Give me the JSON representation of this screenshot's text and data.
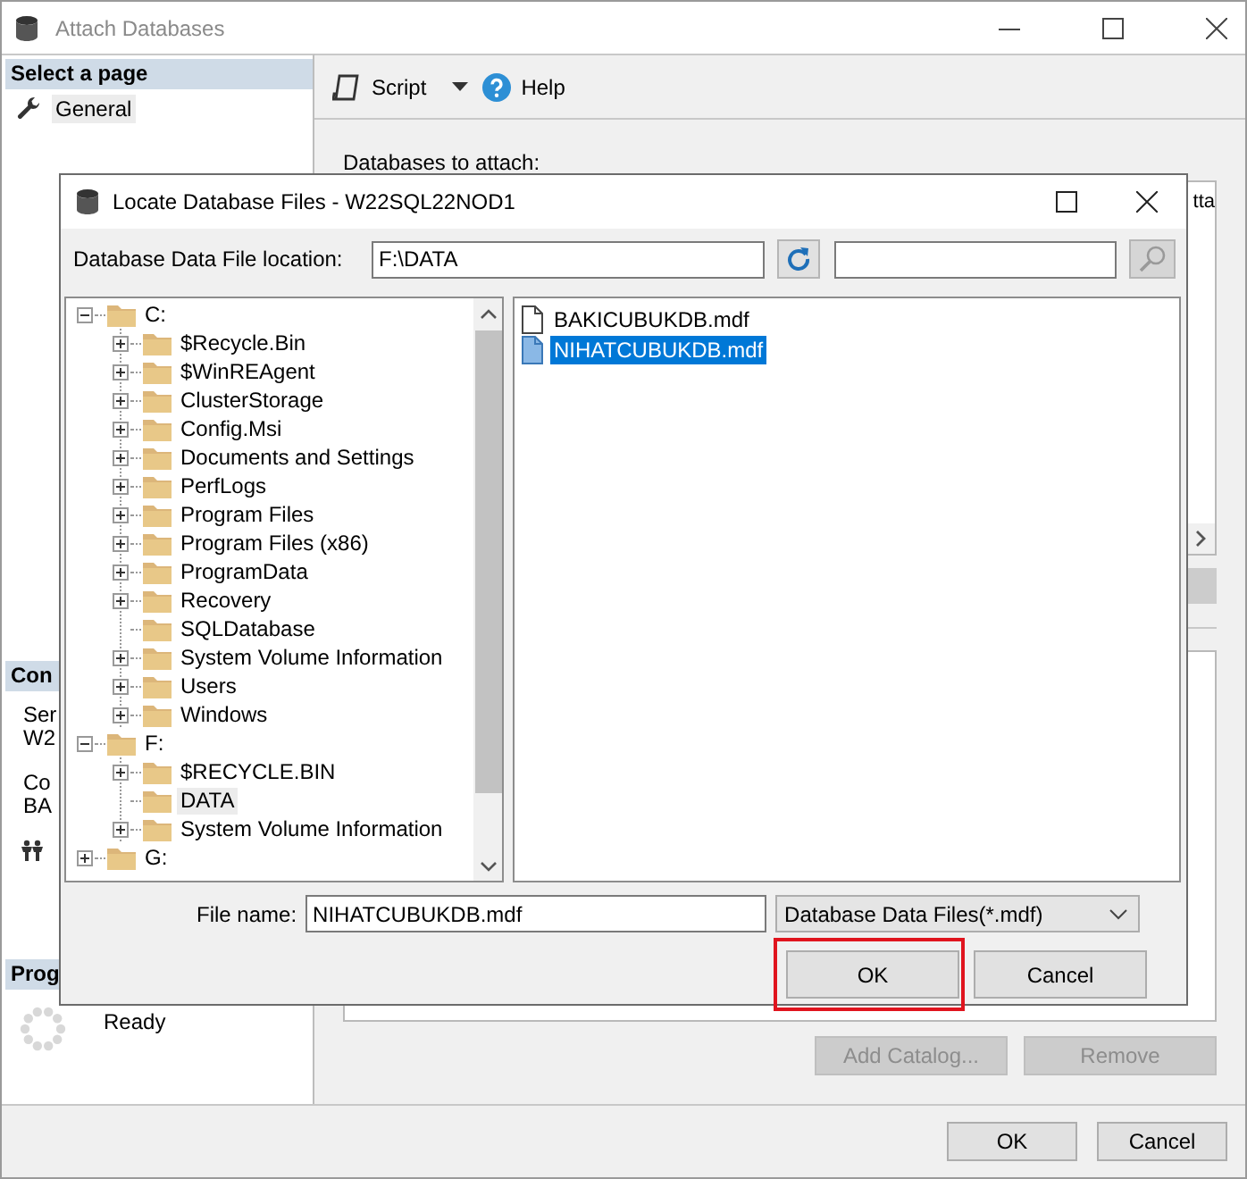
{
  "window": {
    "title": "Attach Databases"
  },
  "sidebar": {
    "sections": [
      {
        "kind": "pages",
        "header": "Select a page",
        "items": [
          {
            "label": "General",
            "selected": true
          }
        ]
      },
      {
        "kind": "connection",
        "header": "Con",
        "lines": [
          "Ser",
          "W2",
          "Co",
          "BA"
        ]
      },
      {
        "kind": "progress",
        "header": "Prog",
        "status": "Ready"
      }
    ]
  },
  "toolbar": {
    "items": [
      {
        "kind": "dropdown",
        "label": "Script"
      },
      {
        "kind": "help",
        "label": "Help"
      }
    ]
  },
  "attach": {
    "label": "Databases to attach:",
    "grid_header": "tta",
    "buttons": [
      {
        "label": "Add Catalog...",
        "disabled": true
      },
      {
        "label": "Remove",
        "disabled": true
      }
    ]
  },
  "footer": {
    "buttons": [
      "OK",
      "Cancel"
    ]
  },
  "dialog": {
    "title": "Locate Database Files - W22SQL22NOD1",
    "location_label": "Database Data File location:",
    "location": "F:\\DATA",
    "tree": [
      {
        "label": "C:",
        "kind": "node",
        "expanded": true,
        "selected": false,
        "children": [
          {
            "label": "$Recycle.Bin",
            "kind": "node",
            "expanded": false,
            "selected": false
          },
          {
            "label": "$WinREAgent",
            "kind": "node",
            "expanded": false,
            "selected": false
          },
          {
            "label": "ClusterStorage",
            "kind": "node",
            "expanded": false,
            "selected": false
          },
          {
            "label": "Config.Msi",
            "kind": "node",
            "expanded": false,
            "selected": false
          },
          {
            "label": "Documents and Settings",
            "kind": "node",
            "expanded": false,
            "selected": false
          },
          {
            "label": "PerfLogs",
            "kind": "node",
            "expanded": false,
            "selected": false
          },
          {
            "label": "Program Files",
            "kind": "node",
            "expanded": false,
            "selected": false
          },
          {
            "label": "Program Files (x86)",
            "kind": "node",
            "expanded": false,
            "selected": false
          },
          {
            "label": "ProgramData",
            "kind": "node",
            "expanded": false,
            "selected": false
          },
          {
            "label": "Recovery",
            "kind": "node",
            "expanded": false,
            "selected": false
          },
          {
            "label": "SQLDatabase",
            "kind": "leaf",
            "selected": false
          },
          {
            "label": "System Volume Information",
            "kind": "node",
            "expanded": false,
            "selected": false
          },
          {
            "label": "Users",
            "kind": "node",
            "expanded": false,
            "selected": false
          },
          {
            "label": "Windows",
            "kind": "node",
            "expanded": false,
            "selected": false
          }
        ]
      },
      {
        "label": "F:",
        "kind": "node",
        "expanded": true,
        "selected": false,
        "children": [
          {
            "label": "$RECYCLE.BIN",
            "kind": "node",
            "expanded": false,
            "selected": false
          },
          {
            "label": "DATA",
            "kind": "leaf",
            "selected": true
          },
          {
            "label": "System Volume Information",
            "kind": "node",
            "expanded": false,
            "selected": false
          }
        ]
      },
      {
        "label": "G:",
        "kind": "node",
        "expanded": false,
        "selected": false
      }
    ],
    "files": [
      {
        "name": "BAKICUBUKDB.mdf",
        "selected": false
      },
      {
        "name": "NIHATCUBUKDB.mdf",
        "selected": true
      }
    ],
    "file_name_label": "File name:",
    "file_name": "NIHATCUBUKDB.mdf",
    "filter": "Database Data Files(*.mdf)",
    "buttons": [
      {
        "label": "OK",
        "highlighted": true
      },
      {
        "label": "Cancel",
        "highlighted": false
      }
    ]
  }
}
